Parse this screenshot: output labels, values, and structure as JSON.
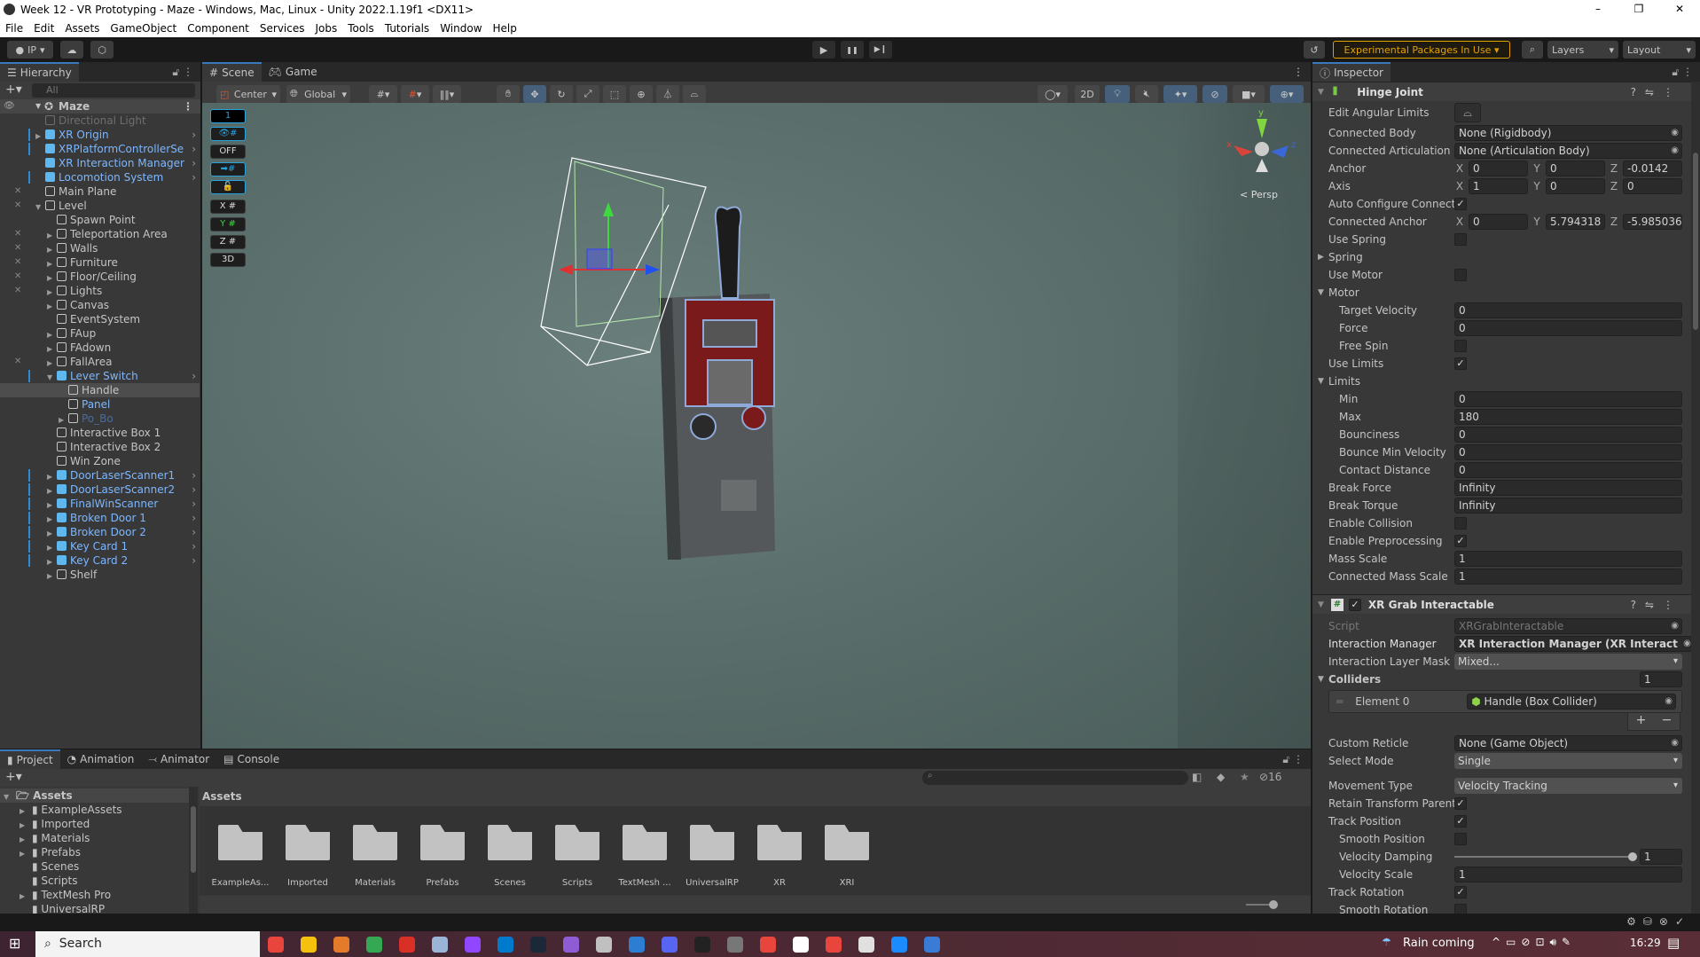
{
  "window": {
    "title": "Week 12 - VR Prototyping - Maze - Windows, Mac, Linux - Unity 2022.1.19f1 <DX11>",
    "controls": [
      "–",
      "❐",
      "✕"
    ]
  },
  "menu": [
    "File",
    "Edit",
    "Assets",
    "GameObject",
    "Component",
    "Services",
    "Jobs",
    "Tools",
    "Tutorials",
    "Window",
    "Help"
  ],
  "toolbar": {
    "account": "IP",
    "play_icons": [
      "▶",
      "❚❚",
      "▶❙"
    ],
    "experimental": "Experimental Packages In Use ▾",
    "layers": "Layers",
    "layout": "Layout",
    "accent_color": "#e0a000"
  },
  "hierarchy": {
    "tab": "Hierarchy",
    "search_placeholder": "All",
    "scene": "Maze",
    "items": [
      {
        "label": "Directional Light",
        "depth": 1,
        "dim": true
      },
      {
        "label": "XR Origin",
        "depth": 1,
        "prefab": true,
        "collapsed": true,
        "go": true,
        "bar": true
      },
      {
        "label": "XRPlatformControllerSe",
        "depth": 1,
        "prefab": true,
        "go": true,
        "bar": true
      },
      {
        "label": "XR Interaction Manager",
        "depth": 1,
        "prefab": true,
        "go": true
      },
      {
        "label": "Locomotion System",
        "depth": 1,
        "prefab": true,
        "go": true,
        "bar": true
      },
      {
        "label": "Main Plane",
        "depth": 1,
        "hidden": true
      },
      {
        "label": "Level",
        "depth": 1,
        "expanded": true,
        "hidden": true
      },
      {
        "label": "Spawn Point",
        "depth": 2
      },
      {
        "label": "Teleportation Area",
        "depth": 2,
        "collapsed": true,
        "hidden": true
      },
      {
        "label": "Walls",
        "depth": 2,
        "collapsed": true,
        "hidden": true
      },
      {
        "label": "Furniture",
        "depth": 2,
        "collapsed": true,
        "hidden": true
      },
      {
        "label": "Floor/Ceiling",
        "depth": 2,
        "collapsed": true,
        "hidden": true
      },
      {
        "label": "Lights",
        "depth": 2,
        "collapsed": true,
        "hidden": true
      },
      {
        "label": "Canvas",
        "depth": 2,
        "collapsed": true
      },
      {
        "label": "EventSystem",
        "depth": 2
      },
      {
        "label": "FAup",
        "depth": 2,
        "collapsed": true
      },
      {
        "label": "FAdown",
        "depth": 2,
        "collapsed": true
      },
      {
        "label": "FallArea",
        "depth": 2,
        "collapsed": true,
        "hidden": true
      },
      {
        "label": "Lever Switch",
        "depth": 2,
        "prefab": true,
        "expanded": true,
        "go": true,
        "bar": true
      },
      {
        "label": "Handle",
        "depth": 3,
        "selected": true
      },
      {
        "label": "Panel",
        "depth": 3,
        "blue": true
      },
      {
        "label": "Po_Bo",
        "depth": 3,
        "collapsed": true,
        "dimblue": true
      },
      {
        "label": "Interactive Box 1",
        "depth": 2
      },
      {
        "label": "Interactive Box 2",
        "depth": 2
      },
      {
        "label": "Win Zone",
        "depth": 2
      },
      {
        "label": "DoorLaserScanner1",
        "depth": 2,
        "prefab": true,
        "collapsed": true,
        "go": true,
        "bar": true
      },
      {
        "label": "DoorLaserScanner2",
        "depth": 2,
        "prefab": true,
        "collapsed": true,
        "go": true,
        "bar": true
      },
      {
        "label": "FinalWinScanner",
        "depth": 2,
        "prefab": true,
        "collapsed": true,
        "go": true,
        "bar": true
      },
      {
        "label": "Broken Door 1",
        "depth": 2,
        "prefab": true,
        "collapsed": true,
        "go": true,
        "bar": true
      },
      {
        "label": "Broken Door 2",
        "depth": 2,
        "prefab": true,
        "collapsed": true,
        "go": true,
        "bar": true
      },
      {
        "label": "Key Card 1",
        "depth": 2,
        "prefab": true,
        "collapsed": true,
        "go": true,
        "bar": true
      },
      {
        "label": "Key Card 2",
        "depth": 2,
        "prefab": true,
        "collapsed": true,
        "go": true,
        "bar": true
      },
      {
        "label": "Shelf",
        "depth": 2,
        "collapsed": true
      }
    ]
  },
  "scene": {
    "tabs": [
      "Scene",
      "Game"
    ],
    "pivot": "Center",
    "space": "Global",
    "overlay_buttons": [
      "1",
      "👁#",
      "OFF",
      "➡#",
      "🔓",
      "X #",
      "Y #",
      "Z #",
      "3D"
    ],
    "mode_2d": "2D",
    "persp": "< Persp",
    "gizmo_axes": [
      "y",
      "x",
      "z"
    ]
  },
  "inspector": {
    "tab": "Inspector",
    "hinge": {
      "title": "Hinge Joint",
      "edit_label": "Edit Angular Limits",
      "rows": [
        {
          "label": "Connected Body",
          "object": "None (Rigidbody)"
        },
        {
          "label": "Connected Articulation Body",
          "object": "None (Articulation Body)"
        },
        {
          "label": "Anchor",
          "xyz": [
            "0",
            "0",
            "-0.0142"
          ]
        },
        {
          "label": "Axis",
          "xyz": [
            "1",
            "0",
            "0"
          ]
        },
        {
          "label": "Auto Configure Connected Anchor",
          "checked": true
        },
        {
          "label": "Connected Anchor",
          "xyz": [
            "0",
            "5.794318",
            "-5.985036"
          ]
        },
        {
          "label": "Use Spring",
          "checked": false
        },
        {
          "label": "Spring",
          "fold": false
        },
        {
          "label": "Use Motor",
          "checked": false
        },
        {
          "label": "Motor",
          "fold": true
        },
        {
          "label": "Target Velocity",
          "value": "0",
          "depth": 1
        },
        {
          "label": "Force",
          "value": "0",
          "depth": 1
        },
        {
          "label": "Free Spin",
          "checked": false,
          "depth": 1
        },
        {
          "label": "Use Limits",
          "checked": true
        },
        {
          "label": "Limits",
          "fold": true
        },
        {
          "label": "Min",
          "value": "0",
          "depth": 1
        },
        {
          "label": "Max",
          "value": "180",
          "depth": 1
        },
        {
          "label": "Bounciness",
          "value": "0",
          "depth": 1
        },
        {
          "label": "Bounce Min Velocity",
          "value": "0",
          "depth": 1
        },
        {
          "label": "Contact Distance",
          "value": "0",
          "depth": 1
        },
        {
          "label": "Break Force",
          "value": "Infinity"
        },
        {
          "label": "Break Torque",
          "value": "Infinity"
        },
        {
          "label": "Enable Collision",
          "checked": false
        },
        {
          "label": "Enable Preprocessing",
          "checked": true
        },
        {
          "label": "Mass Scale",
          "value": "1"
        },
        {
          "label": "Connected Mass Scale",
          "value": "1"
        }
      ]
    },
    "grab": {
      "title": "XR Grab Interactable",
      "rows_a": [
        {
          "label": "Script",
          "object": "XRGrabInteractable",
          "disabled": true
        },
        {
          "label": "Interaction Manager",
          "object": "XR Interaction Manager (XR Interact",
          "bold": true
        },
        {
          "label": "Interaction Layer Mask",
          "dropdown": "Mixed..."
        }
      ],
      "colliders_label": "Colliders",
      "colliders_count": "1",
      "element_label": "Element 0",
      "element_value": "Handle (Box Collider)",
      "add": "+",
      "remove": "−",
      "rows_b": [
        {
          "label": "Custom Reticle",
          "object": "None (Game Object)"
        },
        {
          "label": "Select Mode",
          "dropdown": "Single"
        }
      ],
      "rows_c": [
        {
          "label": "Movement Type",
          "dropdown": "Velocity Tracking"
        },
        {
          "label": "Retain Transform Parent",
          "checked": true
        },
        {
          "label": "Track Position",
          "checked": true
        },
        {
          "label": "Smooth Position",
          "checked": false,
          "depth": 1
        },
        {
          "label": "Velocity Damping",
          "slider": 1,
          "value": "1",
          "depth": 1
        },
        {
          "label": "Velocity Scale",
          "value": "1",
          "depth": 1
        },
        {
          "label": "Track Rotation",
          "checked": true
        },
        {
          "label": "Smooth Rotation",
          "checked": false,
          "depth": 1
        }
      ]
    }
  },
  "project": {
    "tabs": [
      "Project",
      "Animation",
      "Animator",
      "Console"
    ],
    "hidden_count": "16",
    "tree": [
      {
        "label": "Assets",
        "root": true
      },
      {
        "label": "ExampleAssets",
        "arrow": true
      },
      {
        "label": "Imported",
        "arrow": true
      },
      {
        "label": "Materials",
        "arrow": true
      },
      {
        "label": "Prefabs",
        "arrow": true
      },
      {
        "label": "Scenes"
      },
      {
        "label": "Scripts"
      },
      {
        "label": "TextMesh Pro",
        "arrow": true
      },
      {
        "label": "UniversalRP"
      }
    ],
    "breadcrumb": "Assets",
    "folders": [
      "ExampleAs...",
      "Imported",
      "Materials",
      "Prefabs",
      "Scenes",
      "Scripts",
      "TextMesh ...",
      "UniversalRP",
      "XR",
      "XRI"
    ]
  },
  "taskbar": {
    "search": "Search",
    "weather": "Rain coming",
    "time": "16:29",
    "apps": [
      "#e8453c",
      "#f4c20d",
      "#e37b2a",
      "#34a853",
      "#d93025",
      "#9bb5d8",
      "#9146ff",
      "#007acc",
      "#1b2838",
      "#8f5cd6",
      "#c0c0c0",
      "#2d7dd2",
      "#5865f2",
      "#222222",
      "#777777",
      "#e8453c",
      "#ffffff",
      "#e8453c",
      "#e0e0e0",
      "#1a8cff",
      "#3a7bd5"
    ]
  }
}
